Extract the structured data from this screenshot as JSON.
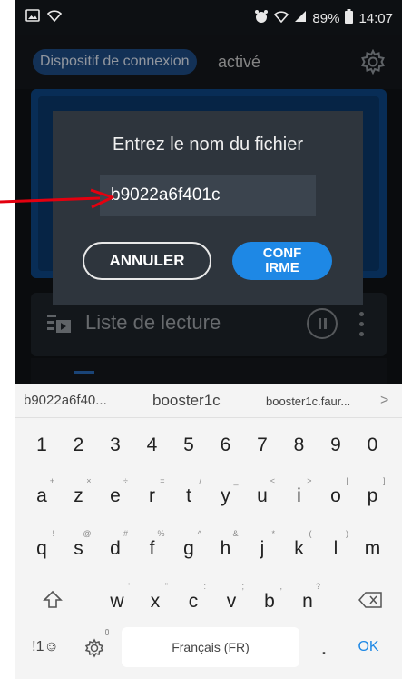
{
  "status_bar": {
    "battery": "89%",
    "time": "14:07"
  },
  "header": {
    "connection_device": "Dispositif de connexion",
    "connection_state": "activé"
  },
  "dialog": {
    "title": "Entrez le nom du fichier",
    "filename_value": "b9022a6f401c",
    "cancel_label": "ANNULER",
    "confirm_label": "CONF\nIRME"
  },
  "playlist": {
    "label": "Liste de lecture"
  },
  "keyboard": {
    "suggestions": [
      "b9022a6f40...",
      "booster1c",
      "booster1c.faur...",
      ">"
    ],
    "row_numbers": [
      "1",
      "2",
      "3",
      "4",
      "5",
      "6",
      "7",
      "8",
      "9",
      "0"
    ],
    "row_top": [
      {
        "key": "a",
        "sub": "+"
      },
      {
        "key": "z",
        "sub": "×"
      },
      {
        "key": "e",
        "sub": "÷"
      },
      {
        "key": "r",
        "sub": "="
      },
      {
        "key": "t",
        "sub": "/"
      },
      {
        "key": "y",
        "sub": "_"
      },
      {
        "key": "u",
        "sub": "<"
      },
      {
        "key": "i",
        "sub": ">"
      },
      {
        "key": "o",
        "sub": "["
      },
      {
        "key": "p",
        "sub": "]"
      }
    ],
    "row_middle": [
      {
        "key": "q",
        "sub": "!"
      },
      {
        "key": "s",
        "sub": "@"
      },
      {
        "key": "d",
        "sub": "#"
      },
      {
        "key": "f",
        "sub": "%"
      },
      {
        "key": "g",
        "sub": "^"
      },
      {
        "key": "h",
        "sub": "&"
      },
      {
        "key": "j",
        "sub": "*"
      },
      {
        "key": "k",
        "sub": "("
      },
      {
        "key": "l",
        "sub": ")"
      },
      {
        "key": "m",
        "sub": ""
      }
    ],
    "row_bottom": [
      {
        "key": "w",
        "sub": "'"
      },
      {
        "key": "x",
        "sub": "\""
      },
      {
        "key": "c",
        "sub": ":"
      },
      {
        "key": "v",
        "sub": ";"
      },
      {
        "key": "b",
        "sub": ","
      },
      {
        "key": "n",
        "sub": "?"
      }
    ],
    "symbols_label": "!1☺",
    "space_label": "Français (FR)",
    "period_label": ".",
    "ok_label": "OK"
  },
  "colors": {
    "accent_blue": "#1e88e5",
    "annotation_arrow": "#e3000f"
  },
  "icons": [
    "image-icon",
    "wifi-icon",
    "alarm-icon",
    "signal-icon",
    "battery-icon",
    "gear-icon",
    "playlist-icon",
    "pause-icon",
    "more-icon",
    "shift-icon",
    "backspace-icon",
    "settings-icon",
    "mic-icon",
    "arrow-icon"
  ]
}
